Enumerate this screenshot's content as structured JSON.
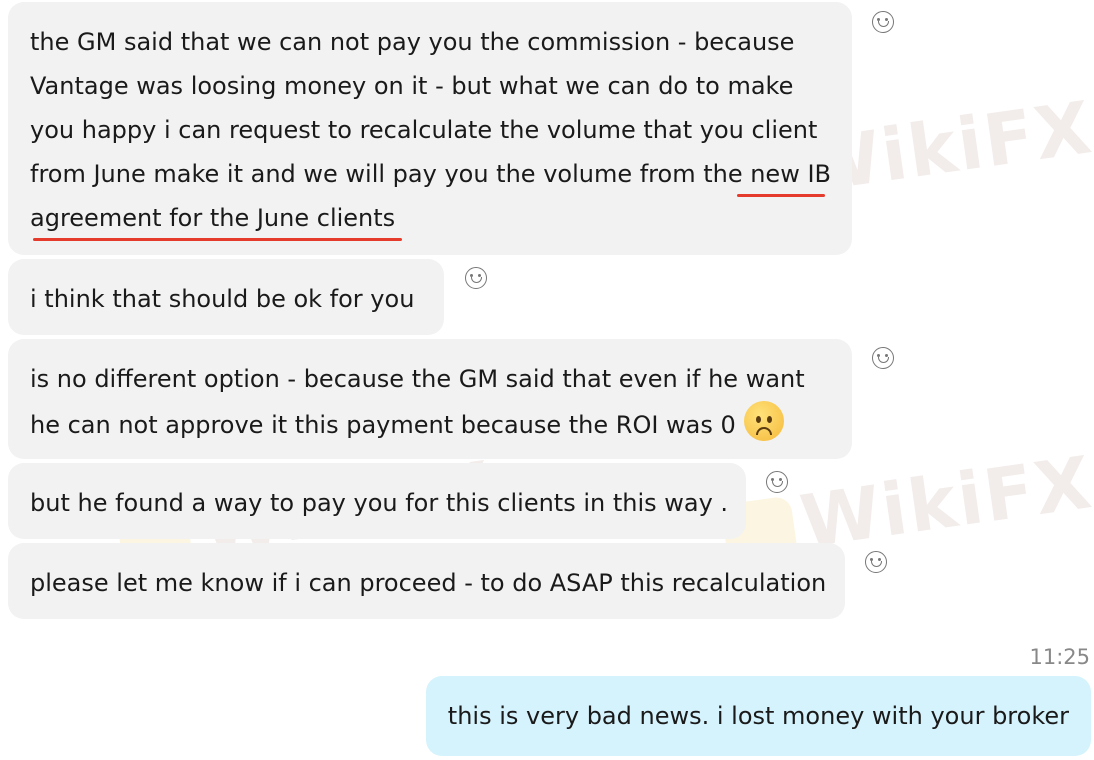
{
  "messages": [
    {
      "lines": [
        "the GM said that we can not pay you the commission - because",
        "Vantage was loosing money on it - but what we can do to make",
        "you happy i can request to recalculate the volume that you client",
        "from June make it and we will pay you the volume from the new IB",
        "agreement for the June clients"
      ],
      "reaction_icon": "smile-reaction-icon"
    },
    {
      "lines": [
        "i think that should be ok for you"
      ],
      "reaction_icon": "smile-reaction-icon"
    },
    {
      "lines": [
        "is no different option - because the GM said that even if he want",
        "he can not approve it this payment because the ROI was 0"
      ],
      "emoji": "sad-face-emoji",
      "reaction_icon": "smile-reaction-icon"
    },
    {
      "lines": [
        "but he found a way to pay you for this clients in this way ."
      ],
      "reaction_icon": "smile-reaction-icon"
    },
    {
      "lines": [
        "please let me know if i can proceed - to do ASAP this recalculation"
      ],
      "reaction_icon": "smile-reaction-icon"
    }
  ],
  "outgoing": {
    "time": "11:25",
    "text": "this is very bad news. i lost money with your broker"
  },
  "watermark": "WikiFX",
  "colors": {
    "incoming_bubble": "#f2f2f2",
    "outgoing_bubble": "#d5f3fd",
    "highlight_underline": "#e53b2c"
  }
}
